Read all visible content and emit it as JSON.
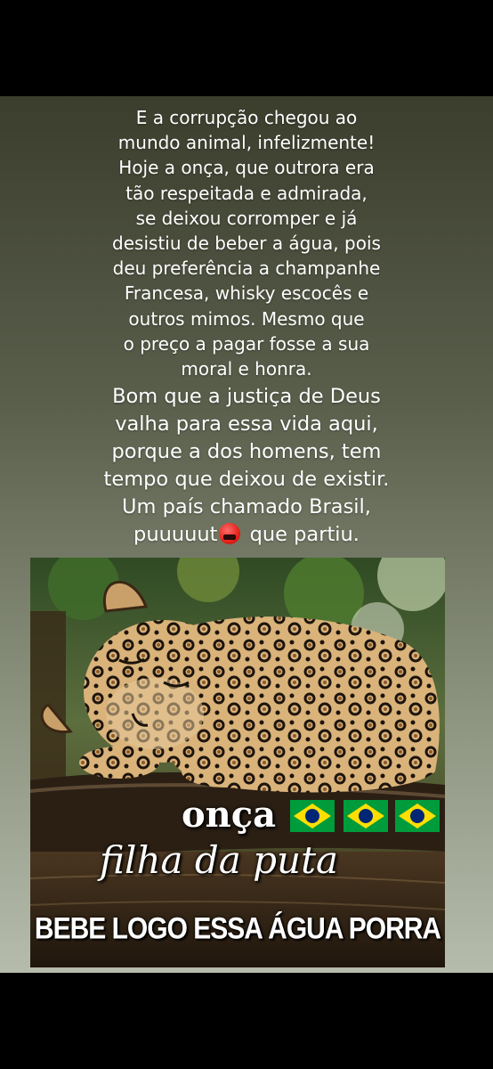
{
  "story": {
    "paragraph1": [
      "E a corrupção chegou ao",
      "mundo animal, infelizmente!",
      "Hoje a onça, que outrora era",
      "tão respeitada e admirada,",
      "se deixou corromper e já",
      "desistiu de beber a água, pois",
      "deu preferência a champanhe",
      "Francesa, whisky escocês e",
      "outros mimos. Mesmo que",
      "o preço a pagar fosse a sua",
      "moral e honra."
    ],
    "paragraph2": [
      "Bom que a justiça de Deus",
      "valha para essa vida aqui,",
      "porque a dos homens, tem",
      "tempo que deixou de existir.",
      "Um país chamado Brasil,"
    ],
    "last_line_start": "puuuuut",
    "last_line_end": " que partiu.",
    "emoji_icon": "angry-cursing-face",
    "background_colors": [
      "#3b3d2d",
      "#b6bcac"
    ]
  },
  "meme": {
    "caption_1": "onça",
    "caption_2": "filha da puta",
    "caption_3": "BEBE LOGO ESSA ÁGUA PORRA",
    "flag_icon": "brazil-flag",
    "flag_count": 3,
    "flag_colors": [
      "#009c3b",
      "#ffdf00",
      "#002776"
    ]
  }
}
